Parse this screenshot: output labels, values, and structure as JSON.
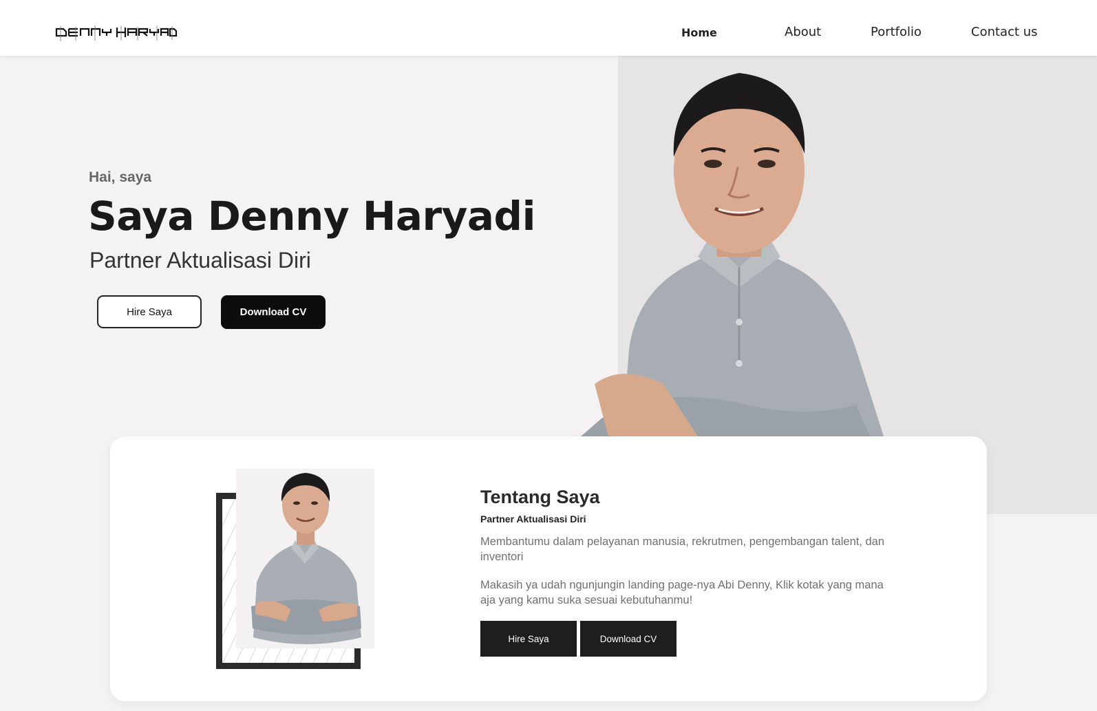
{
  "nav": {
    "logo_text": "DENNY HARYADI",
    "home": "Home",
    "about": "About",
    "portfolio": "Portfolio",
    "contact": "Contact us"
  },
  "hero": {
    "greeting": "Hai, saya",
    "title": "Saya Denny Haryadi",
    "subtitle": "Partner Aktualisasi Diri",
    "hire_label": "Hire Saya",
    "download_label": "Download CV"
  },
  "about": {
    "heading": "Tentang Saya",
    "subheading": "Partner Aktualisasi Diri",
    "paragraph1": "Membantumu dalam pelayanan manusia, rekrutmen, pengembangan talent, dan inventori",
    "paragraph2": "Makasih ya udah ngunjungin landing page-nya Abi Denny, Klik kotak yang mana aja yang kamu suka sesuai kebutuhanmu!",
    "hire_label": "Hire Saya",
    "download_label": "Download CV"
  },
  "colors": {
    "page_bg": "#f4f2f3",
    "hero_panel": "#e6e4e5",
    "dark_button": "#0d0d0d",
    "card_button": "#1e1e1e",
    "shirt": "#a7adb3"
  },
  "icons": {
    "logo": "glitch-wordmark",
    "hero_photo": "person-portrait",
    "about_photo": "person-portrait"
  }
}
